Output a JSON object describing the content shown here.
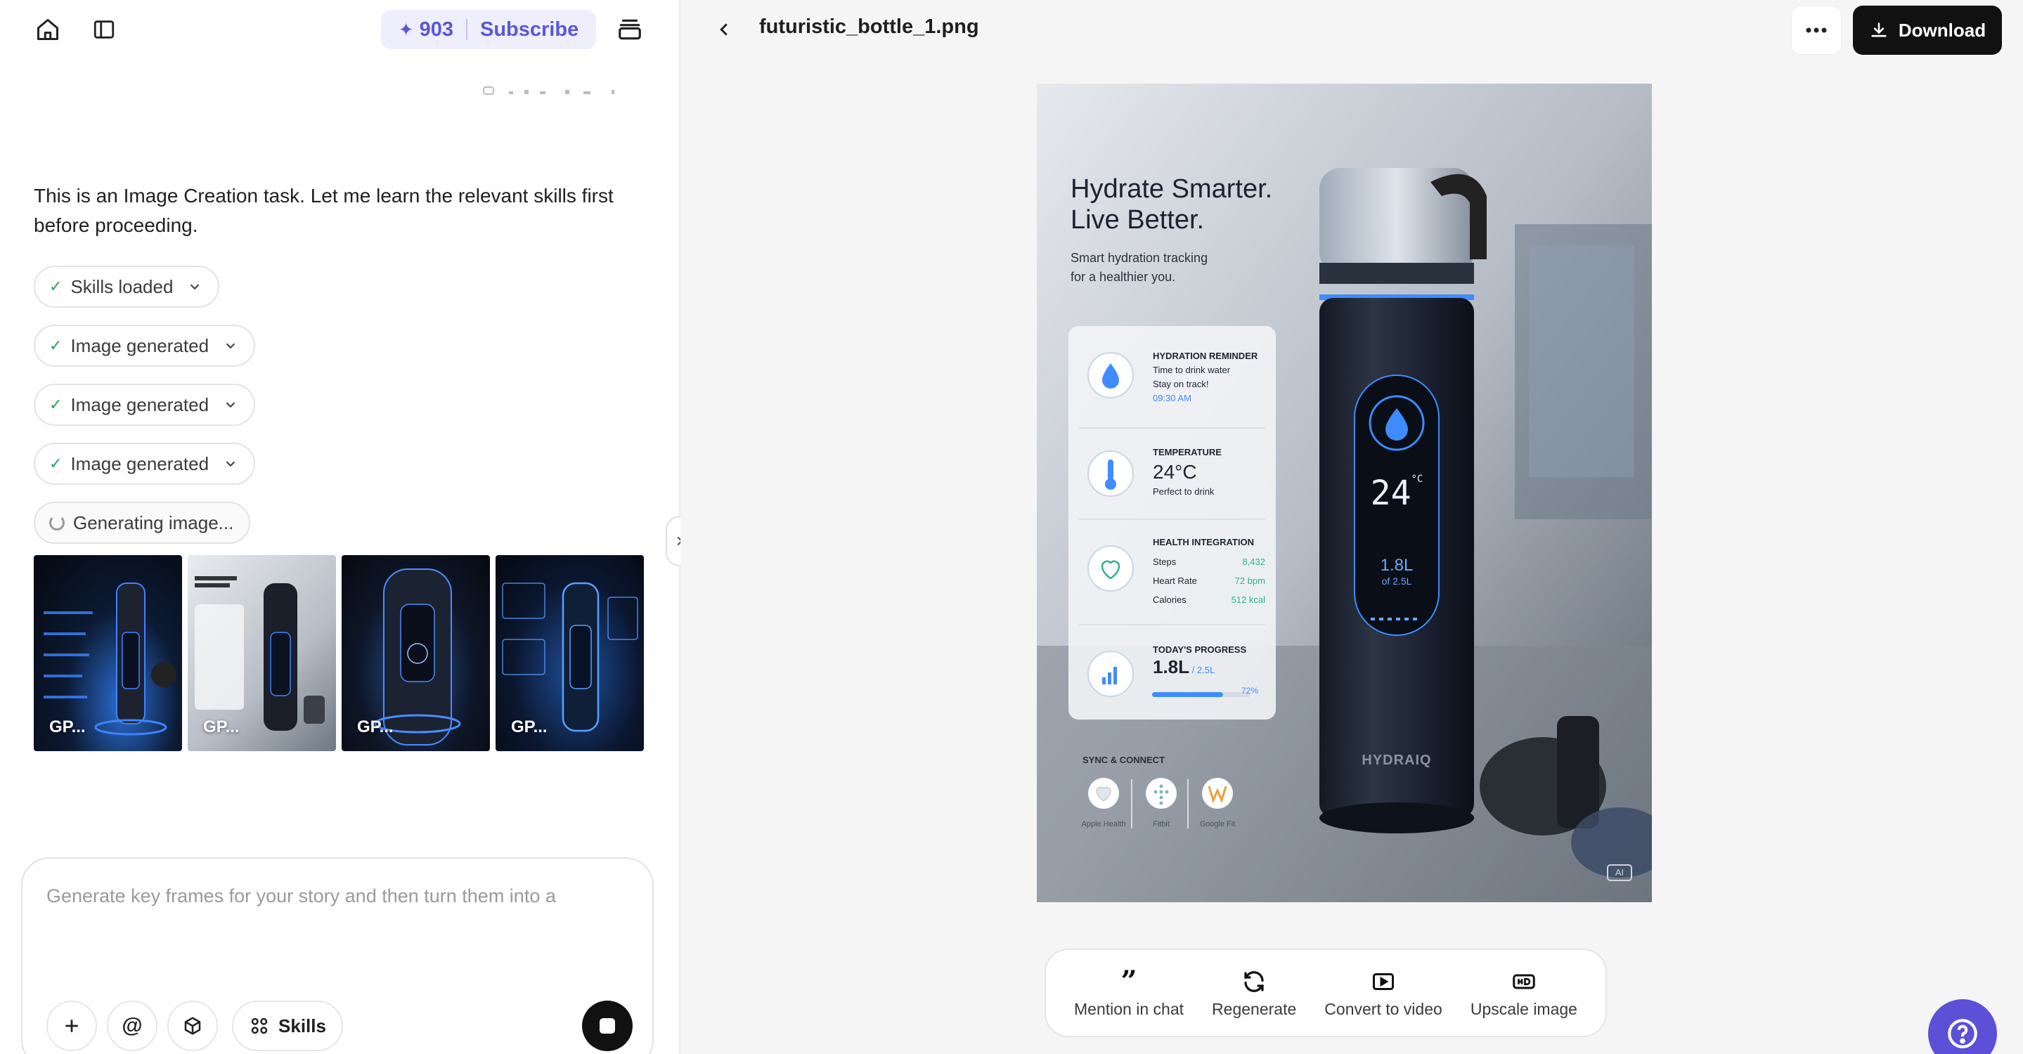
{
  "left": {
    "credits": {
      "count": "903",
      "subscribe": "Subscribe"
    },
    "message": "This is an Image Creation task. Let me learn the relevant skills first before proceeding.",
    "steps": [
      {
        "label": "Skills loaded"
      },
      {
        "label": "Image generated"
      },
      {
        "label": "Image generated"
      },
      {
        "label": "Image generated"
      }
    ],
    "generating": "Generating image...",
    "thumbnails": [
      {
        "label": "GP..."
      },
      {
        "label": "GP..."
      },
      {
        "label": "GP..."
      },
      {
        "label": "GP..."
      }
    ],
    "composer": {
      "placeholder": "Generate key frames for your story and then turn them into a",
      "skills_label": "Skills"
    }
  },
  "right": {
    "file_name": "futuristic_bottle_1.png",
    "download_label": "Download",
    "image": {
      "headline_1": "Hydrate Smarter.",
      "headline_2": "Live Better.",
      "sub_1": "Smart hydration tracking",
      "sub_2": "for a healthier you.",
      "cards": {
        "reminder_title": "HYDRATION REMINDER",
        "reminder_l1": "Time to drink water",
        "reminder_l2": "Stay on track!",
        "reminder_time": "09:30 AM",
        "temp_title": "TEMPERATURE",
        "temp_value": "24°C",
        "temp_sub": "Perfect to drink",
        "health_title": "HEALTH INTEGRATION",
        "steps_label": "Steps",
        "steps_value": "8,432",
        "hr_label": "Heart Rate",
        "hr_value": "72 bpm",
        "cal_label": "Calories",
        "cal_value": "512 kcal",
        "progress_title": "TODAY'S PROGRESS",
        "progress_value": "1.8L",
        "progress_total": "/ 2.5L",
        "progress_pct": "72%",
        "progress_fraction": 0.72
      },
      "sync_title": "SYNC & CONNECT",
      "sync_items": [
        "Apple Health",
        "Fitbit",
        "Google Fit"
      ],
      "bottle_temp": "24",
      "bottle_temp_unit": "°C",
      "bottle_volume": "1.8L",
      "bottle_volume_sub": "of 2.5L",
      "brand": "HYDRAIQ",
      "ai_badge": "AI"
    },
    "actions": [
      {
        "label": "Mention in chat"
      },
      {
        "label": "Regenerate"
      },
      {
        "label": "Convert to video"
      },
      {
        "label": "Upscale image"
      }
    ]
  },
  "colors": {
    "accent": "#5b57d6",
    "credits_bg": "#eeeefd",
    "success": "#2e9e5b",
    "help": "#5b50d6"
  }
}
